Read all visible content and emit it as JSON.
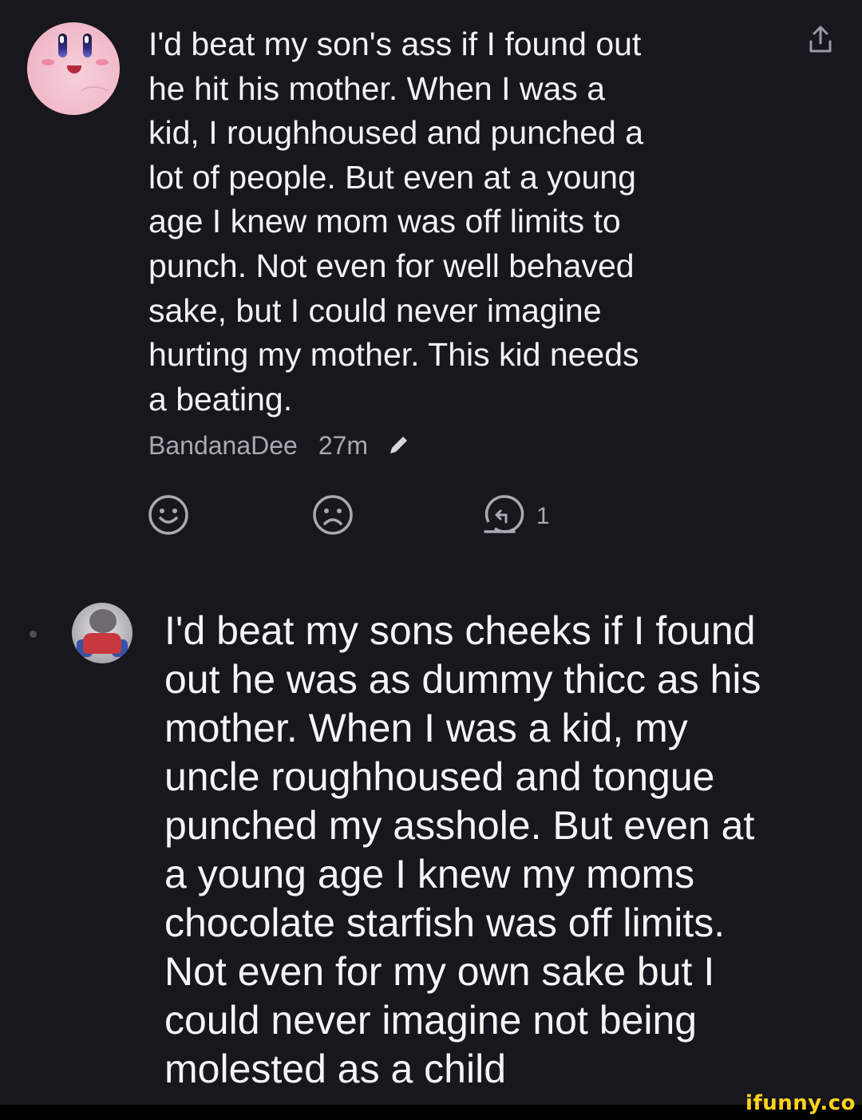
{
  "comment1": {
    "text": "I'd beat my son's ass if I found out\nhe hit his mother. When I was a\nkid, I roughhoused and punched a\nlot of people. But even at a young\nage I knew mom was off limits to\npunch. Not even for well behaved\nsake, but I could never imagine\nhurting my mother. This kid needs\na beating.",
    "username": "BandanaDee",
    "time": "27m",
    "reply_count": "1",
    "avatar_icon": "kirby-avatar",
    "share_icon": "share-icon",
    "edit_icon": "pencil-icon"
  },
  "actions": {
    "happy_icon": "smile-icon",
    "sad_icon": "frown-icon",
    "reply_icon": "reply-icon"
  },
  "comment2": {
    "text": "I'd beat my sons cheeks if I found\nout he was as dummy thicc as his\nmother. When I was a kid, my\nuncle roughhoused and tongue\npunched my asshole. But even at\na young age I knew my moms\nchocolate starfish was off limits.\nNot even for my own sake but I\ncould never imagine not being\nmolested as a child",
    "avatar_icon": "cat-avatar"
  },
  "watermark": "ifunny.co",
  "colors": {
    "background": "#18171d",
    "text": "#f2f2f5",
    "meta": "#a9a9b3",
    "watermark": "#ffd21f"
  }
}
